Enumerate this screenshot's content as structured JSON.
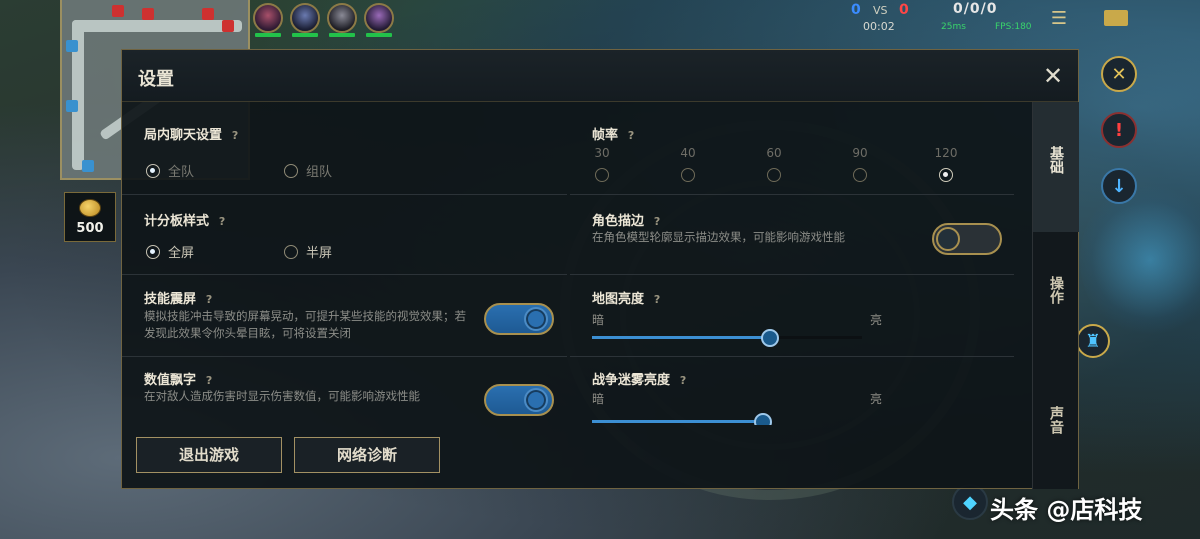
{
  "hud": {
    "score_blue": "0",
    "score_vs": "VS",
    "score_red": "0",
    "kda": "0/0/0",
    "timer": "00:02",
    "ping": "25ms",
    "fps_readout": "FPS:180",
    "gold": "500"
  },
  "settings": {
    "title": "设置",
    "close_icon": "close-icon",
    "chat": {
      "label": "局内聊天设置",
      "options": [
        "全队",
        "组队"
      ],
      "selected": "全队"
    },
    "scoreboard": {
      "label": "计分板样式",
      "options": [
        "全屏",
        "半屏"
      ],
      "selected": "全屏"
    },
    "screen_shake": {
      "label": "技能震屏",
      "desc": "模拟技能冲击导致的屏幕晃动，可提升某些技能的视觉效果；若发现此效果令你头晕目眩，可将设置关闭",
      "on": true
    },
    "damage_numbers": {
      "label": "数值飘字",
      "desc": "在对敌人造成伤害时显示伤害数值，可能影响游戏性能",
      "on": true
    },
    "frame_rate": {
      "label": "帧率",
      "options": [
        "30",
        "40",
        "60",
        "90",
        "120"
      ],
      "selected": "120"
    },
    "outline": {
      "label": "角色描边",
      "desc": "在角色模型轮廓显示描边效果，可能影响游戏性能",
      "on": false
    },
    "map_brightness": {
      "label": "地图亮度",
      "min_label": "暗",
      "max_label": "亮",
      "value_fraction": 0.66
    },
    "fog_brightness": {
      "label": "战争迷雾亮度",
      "min_label": "暗",
      "max_label": "亮"
    },
    "buttons": {
      "exit": "退出游戏",
      "network": "网络诊断"
    },
    "tabs": [
      "基础",
      "操作",
      "声音"
    ],
    "active_tab": "基础"
  },
  "watermark": "头条 @店科技",
  "colors": {
    "accent_gold": "#a8904f",
    "toggle_on": "#2a6fb0",
    "score_blue": "#3b8cff",
    "score_red": "#ff4646"
  }
}
